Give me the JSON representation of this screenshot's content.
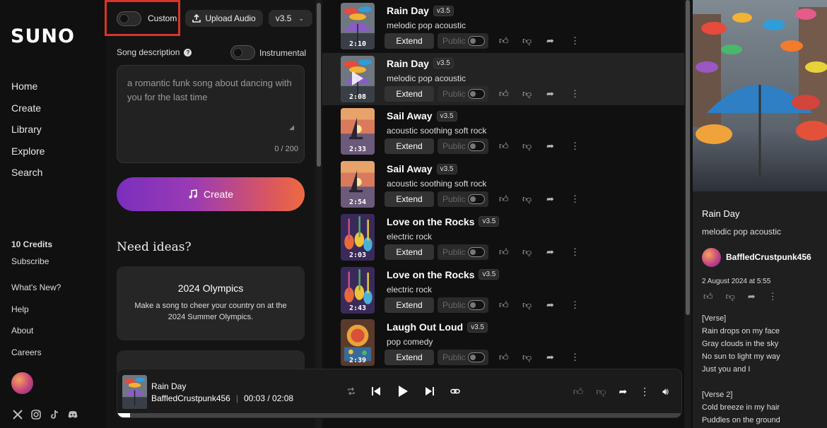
{
  "sidebar": {
    "logo": "SUNO",
    "nav": [
      "Home",
      "Create",
      "Library",
      "Explore",
      "Search"
    ],
    "credits": "10 Credits",
    "subscribe": "Subscribe",
    "links": [
      "What's New?",
      "Help",
      "About",
      "Careers"
    ],
    "socials": [
      "x-icon",
      "instagram-icon",
      "tiktok-icon",
      "discord-icon"
    ]
  },
  "create": {
    "custom_label": "Custom",
    "upload_label": "Upload Audio",
    "version": "v3.5",
    "song_description_label": "Song description",
    "instrumental_label": "Instrumental",
    "description_placeholder": "a romantic funk song about dancing with you for the last time",
    "char_count": "0 / 200",
    "create_label": "Create",
    "ideas_title": "Need ideas?",
    "idea": {
      "title": "2024 Olympics",
      "description": "Make a song to cheer your country on at the 2024 Summer Olympics."
    }
  },
  "songs": [
    {
      "title": "Rain Day",
      "version": "v3.5",
      "style": "melodic pop acoustic",
      "duration": "2:10",
      "art": "umbrella"
    },
    {
      "title": "Rain Day",
      "version": "v3.5",
      "style": "melodic pop acoustic",
      "duration": "2:08",
      "art": "umbrella",
      "active": true
    },
    {
      "title": "Sail Away",
      "version": "v3.5",
      "style": "acoustic soothing soft rock",
      "duration": "2:33",
      "art": "sunset"
    },
    {
      "title": "Sail Away",
      "version": "v3.5",
      "style": "acoustic soothing soft rock",
      "duration": "2:54",
      "art": "sunset"
    },
    {
      "title": "Love on the Rocks",
      "version": "v3.5",
      "style": "electric rock",
      "duration": "2:03",
      "art": "guitars"
    },
    {
      "title": "Love on the Rocks",
      "version": "v3.5",
      "style": "electric rock",
      "duration": "2:43",
      "art": "guitars"
    },
    {
      "title": "Laugh Out Loud",
      "version": "v3.5",
      "style": "pop comedy",
      "duration": "2:39",
      "art": "comedy"
    }
  ],
  "song_actions": {
    "extend": "Extend",
    "public": "Public"
  },
  "player": {
    "title": "Rain Day",
    "artist": "BaffledCrustpunk456",
    "time": "00:03 / 02:08",
    "progress": 0.023
  },
  "detail": {
    "title": "Rain Day",
    "style": "melodic pop acoustic",
    "user": "BaffledCrustpunk456",
    "date": "2 August 2024 at 5:55",
    "lyrics": "[Verse]\nRain drops on my face\nGray clouds in the sky\nNo sun to light my way\nJust you and I\n\n[Verse 2]\nCold breeze in my hair\nPuddles on the ground"
  }
}
